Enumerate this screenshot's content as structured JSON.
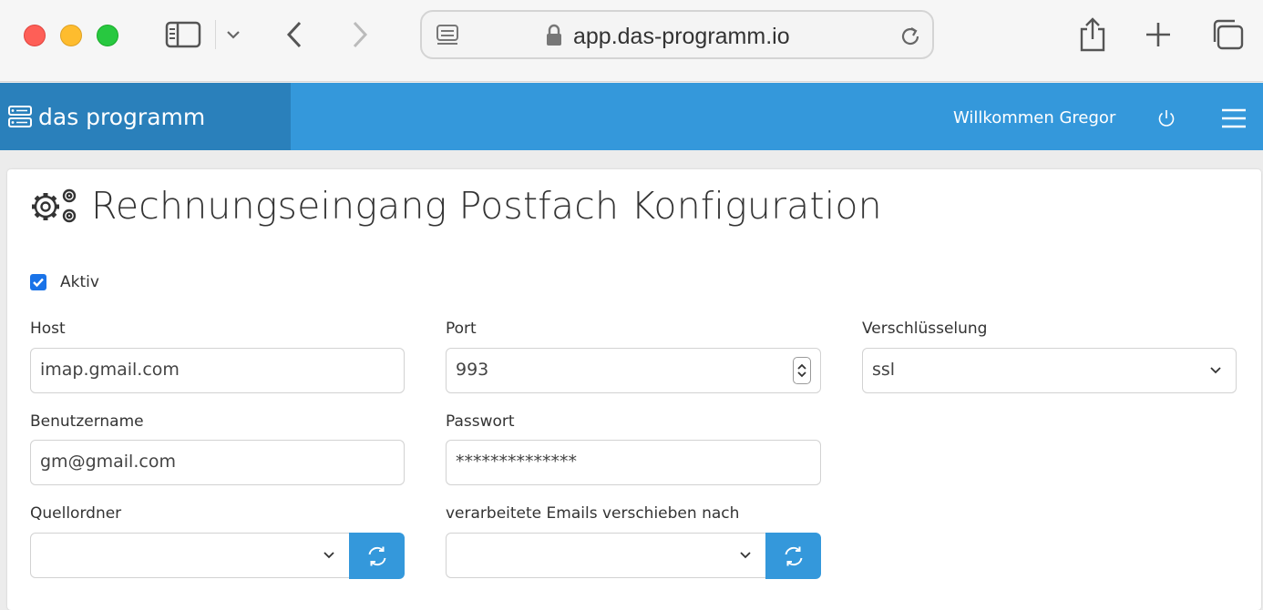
{
  "browser": {
    "url": "app.das-programm.io",
    "icons": [
      "sidebar-icon",
      "chevron-down-icon",
      "back-icon",
      "forward-icon",
      "reader-icon",
      "lock-icon",
      "reload-icon",
      "share-icon",
      "new-tab-icon",
      "tabs-icon"
    ]
  },
  "app": {
    "brand": "das programm",
    "welcome": "Willkommen Gregor",
    "accent": "#3498db",
    "brand_bg": "#2a80bb"
  },
  "page": {
    "title": "Rechnungseingang Postfach Konfiguration",
    "active_label": "Aktiv",
    "active_checked": true
  },
  "form": {
    "host_label": "Host",
    "host_value": "imap.gmail.com",
    "port_label": "Port",
    "port_value": "993",
    "encryption_label": "Verschlüsselung",
    "encryption_value": "ssl",
    "username_label": "Benutzername",
    "username_value": "gm@gmail.com",
    "password_label": "Passwort",
    "password_value": "**************",
    "source_label": "Quellordner",
    "source_value": "",
    "move_label": "verarbeitete Emails verschieben nach",
    "move_value": ""
  }
}
